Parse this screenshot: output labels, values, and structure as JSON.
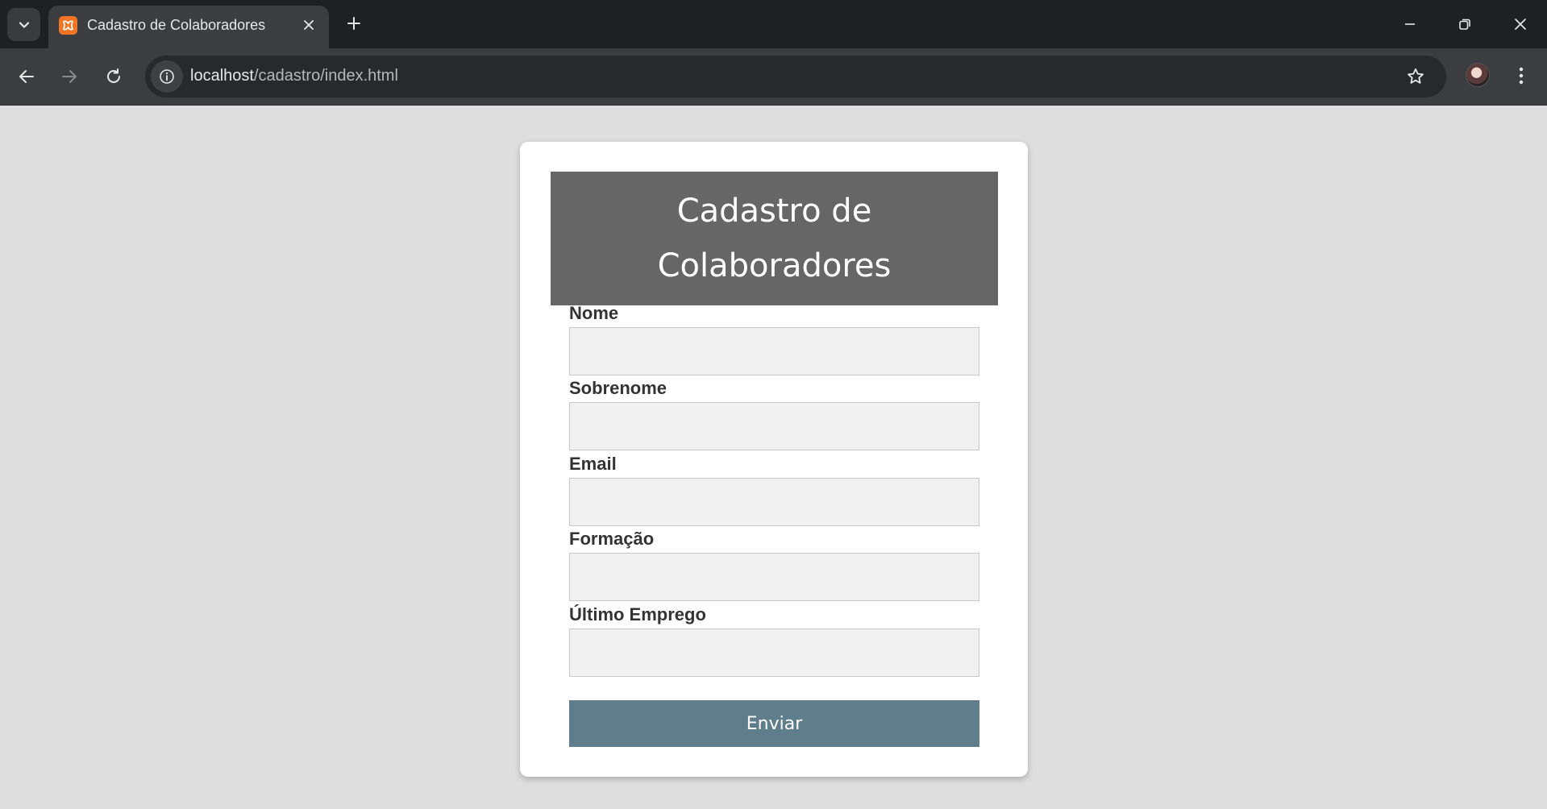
{
  "browser": {
    "tab": {
      "title": "Cadastro de Colaboradores"
    },
    "url": {
      "host": "localhost",
      "path": "/cadastro/index.html"
    }
  },
  "form": {
    "title": "Cadastro de Colaboradores",
    "fields": [
      {
        "label": "Nome",
        "value": "",
        "placeholder": ""
      },
      {
        "label": "Sobrenome",
        "value": "",
        "placeholder": ""
      },
      {
        "label": "Email",
        "value": "",
        "placeholder": ""
      },
      {
        "label": "Formação",
        "value": "",
        "placeholder": ""
      },
      {
        "label": "Último Emprego",
        "value": "",
        "placeholder": ""
      }
    ],
    "submit_label": "Enviar"
  },
  "colors": {
    "header_bg": "#666666",
    "button_bg": "#607d8b",
    "page_bg": "#dedede"
  }
}
